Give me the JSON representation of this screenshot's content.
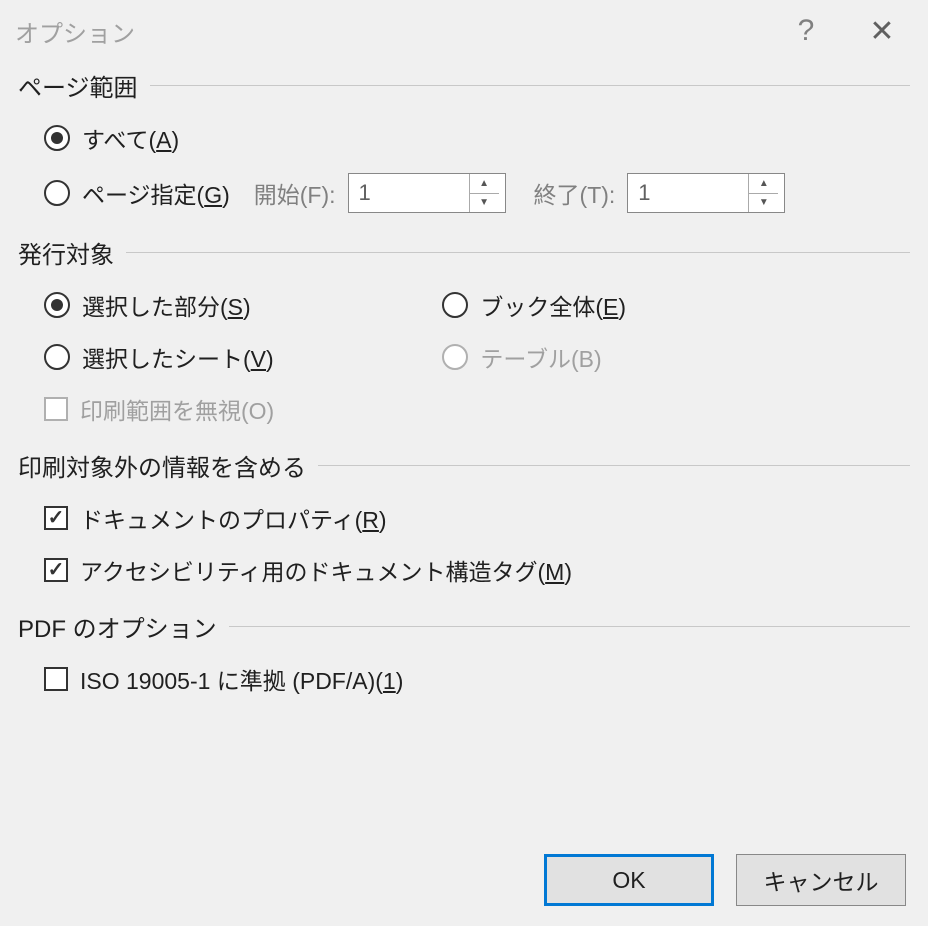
{
  "title": "オプション",
  "sections": {
    "pageRange": {
      "legend": "ページ範囲",
      "all": {
        "prefix": "すべて(",
        "key": "A",
        "suffix": ")"
      },
      "pages": {
        "prefix": "ページ指定(",
        "key": "G",
        "suffix": ")"
      },
      "from": {
        "label": "開始(F):",
        "value": "1"
      },
      "to": {
        "label": "終了(T):",
        "value": "1"
      }
    },
    "publishWhat": {
      "legend": "発行対象",
      "selection": {
        "prefix": "選択した部分(",
        "key": "S",
        "suffix": ")"
      },
      "workbook": {
        "prefix": "ブック全体(",
        "key": "E",
        "suffix": ")"
      },
      "sheets": {
        "prefix": "選択したシート(",
        "key": "V",
        "suffix": ")"
      },
      "table": {
        "label": "テーブル(B)"
      },
      "ignorePrintAreas": {
        "label": "印刷範囲を無視(O)"
      }
    },
    "nonPrint": {
      "legend": "印刷対象外の情報を含める",
      "docProps": {
        "prefix": "ドキュメントのプロパティ(",
        "key": "R",
        "suffix": ")"
      },
      "docTags": {
        "prefix": "アクセシビリティ用のドキュメント構造タグ(",
        "key": "M",
        "suffix": ")"
      }
    },
    "pdf": {
      "legend": "PDF のオプション",
      "iso": {
        "prefix": "ISO 19005-1 に準拠 (PDF/A)(",
        "key": "1",
        "suffix": ")"
      }
    }
  },
  "buttons": {
    "ok": "OK",
    "cancel": "キャンセル"
  }
}
